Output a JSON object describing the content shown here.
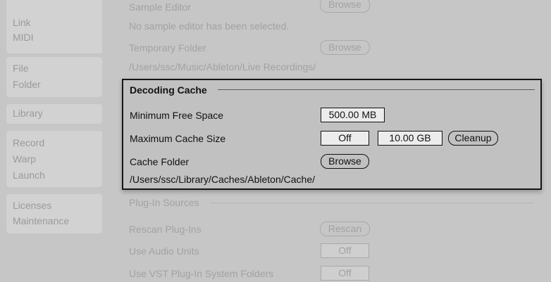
{
  "sidebar": {
    "groups": [
      {
        "items": [
          "Link",
          "MIDI"
        ]
      },
      {
        "items": [
          "File",
          "Folder"
        ]
      },
      {
        "items": [
          "Library"
        ]
      },
      {
        "items": [
          "Record",
          "Warp",
          "Launch"
        ]
      },
      {
        "items": [
          "Licenses",
          "Maintenance"
        ]
      }
    ]
  },
  "sample_editor": {
    "label": "Sample Editor",
    "browse_label": "Browse",
    "status": "No sample editor has been selected."
  },
  "temporary_folder": {
    "label": "Temporary Folder",
    "browse_label": "Browse",
    "path": "/Users/ssc/Music/Ableton/Live Recordings/"
  },
  "decoding_cache": {
    "title": "Decoding Cache",
    "min_free_space_label": "Minimum Free Space",
    "min_free_space_value": "500.00 MB",
    "max_cache_size_label": "Maximum Cache Size",
    "max_cache_toggle": "Off",
    "max_cache_value": "10.00 GB",
    "cleanup_label": "Cleanup",
    "cache_folder_label": "Cache Folder",
    "cache_folder_browse": "Browse",
    "cache_folder_path": "/Users/ssc/Library/Caches/Ableton/Cache/"
  },
  "plugin_sources": {
    "title": "Plug-In Sources",
    "rescan_label": "Rescan Plug-Ins",
    "rescan_button": "Rescan",
    "audio_units_label": "Use Audio Units",
    "audio_units_value": "Off",
    "vst_system_label": "Use VST Plug-In System Folders",
    "vst_system_value": "Off"
  }
}
